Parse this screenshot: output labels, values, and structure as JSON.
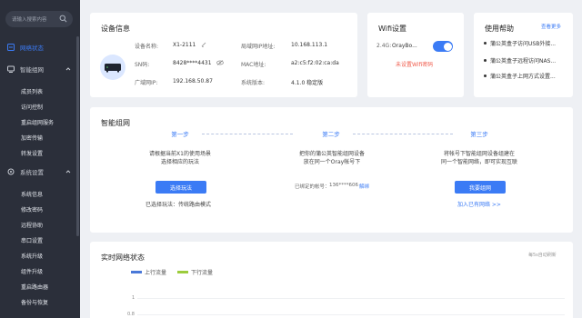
{
  "sidebar": {
    "search_placeholder": "请输入搜索内容",
    "top_items": [
      {
        "label": "网络状态",
        "active": true
      },
      {
        "label": "智能组网",
        "active": false
      },
      {
        "label": "系统设置",
        "active": false
      }
    ],
    "smart_net_items": [
      "成员列表",
      "访问控制",
      "重启组网服务",
      "加密传输",
      "转发设置"
    ],
    "system_items": [
      "系统信息",
      "修改密码",
      "远程协助",
      "串口设置",
      "系统升级",
      "组件升级",
      "重启路由器",
      "备份与恢复"
    ]
  },
  "device_info": {
    "title": "设备信息",
    "name_label": "设备名称:",
    "name_value": "X1-2111",
    "sn_label": "SN码:",
    "sn_value": "8428****4431",
    "wan_label": "广域网IP:",
    "wan_value": "192.168.50.87",
    "lan_label": "局域网IP地址:",
    "lan_value": "10.168.113.1",
    "mac_label": "MAC地址:",
    "mac_value": "a2:c5:f2:02:ca:da",
    "ver_label": "系统版本:",
    "ver_value": "4.1.0 稳定版"
  },
  "wifi": {
    "title": "Wifi设置",
    "band_label": "2.4G:",
    "ssid": "OrayBo...",
    "enabled": true,
    "password_warning": "未设置Wifi密码"
  },
  "help": {
    "title": "使用帮助",
    "more": "查看更多",
    "items": [
      "蒲公英盒子访问USB外接...",
      "蒲公英盒子远程访问NAS...",
      "蒲公英盒子上网方式设置..."
    ]
  },
  "smart_net": {
    "title": "智能组网",
    "steps": [
      {
        "title": "第一步",
        "line1": "请根据当前X1的使用场景",
        "line2": "选择相应的玩法",
        "button": "选择玩法",
        "note": "已选择玩法：传统路由模式"
      },
      {
        "title": "第二步",
        "line1": "把你的蒲公英智能组网设备",
        "line2": "放在同一个Oray帐号下",
        "account_label": "已绑定的帐号：",
        "account_value": "136****606",
        "unbind": "解绑"
      },
      {
        "title": "第三步",
        "line1": "将帐号下智能组网设备组建在",
        "line2": "同一个智能网络，即可实现互联",
        "button": "我要组网",
        "link": "加入已有网络 >>"
      }
    ]
  },
  "realtime": {
    "title": "实时网络状态",
    "refresh_note": "每5s自动刷新"
  },
  "chart_data": {
    "type": "line",
    "series": [
      {
        "name": "上行流量",
        "color": "#4a78d8",
        "values": []
      },
      {
        "name": "下行流量",
        "color": "#9ccc3c",
        "values": []
      }
    ],
    "ytick_labels": [
      "1",
      "0.8"
    ],
    "legend_position": "top-left"
  }
}
